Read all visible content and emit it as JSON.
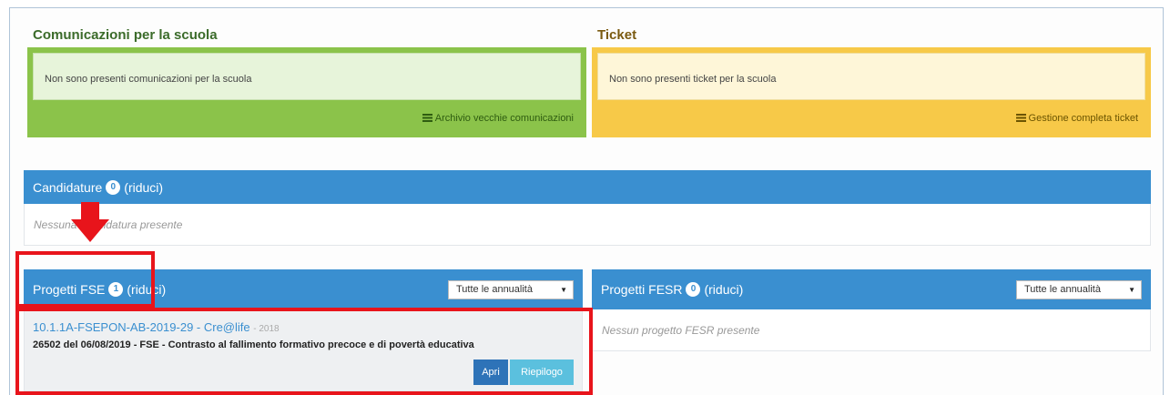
{
  "comunicazioni": {
    "title": "Comunicazioni per la scuola",
    "message": "Non sono presenti comunicazioni per la scuola",
    "archive_link": "Archivio vecchie comunicazioni"
  },
  "ticket": {
    "title": "Ticket",
    "message": "Non sono presenti ticket per la scuola",
    "manage_link": "Gestione completa ticket"
  },
  "candidature": {
    "title": "Candidature",
    "count": "0",
    "toggle": "(riduci)",
    "empty": "Nessuna candidatura presente"
  },
  "progetti_fse": {
    "title": "Progetti FSE",
    "count": "1",
    "toggle": "(riduci)",
    "filter": "Tutte le annualità",
    "project": {
      "code": "10.1.1A-FSEPON-AB-2019-29 - Cre@life",
      "year": "- 2018",
      "description": "26502 del 06/08/2019 - FSE - Contrasto al fallimento formativo precoce e di povertà educativa",
      "open_label": "Apri",
      "summary_label": "Riepilogo"
    }
  },
  "progetti_fesr": {
    "title": "Progetti FESR",
    "count": "0",
    "toggle": "(riduci)",
    "filter": "Tutte le annualità",
    "empty": "Nessun progetto FESR presente"
  },
  "colors": {
    "panel_blue": "#3a8fd0",
    "green": "#8bc34a",
    "yellow": "#f7c948",
    "annotation_red": "#e8141b"
  }
}
